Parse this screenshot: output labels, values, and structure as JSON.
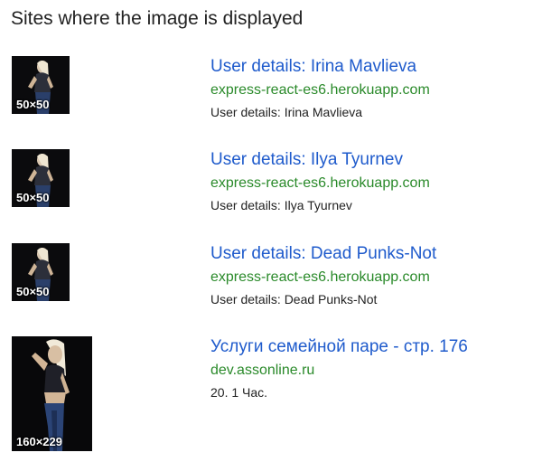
{
  "heading": "Sites where the image is displayed",
  "colors": {
    "title_link": "#1f5bcc",
    "url": "#2a8a2a",
    "text": "#222222",
    "thumb_bg": "#0b0b0d"
  },
  "results": [
    {
      "thumb_size": "50×50",
      "title": "User details: Irina Mavlieva",
      "url": "express-react-es6.herokuapp.com",
      "snippet": "User details: Irina Mavlieva"
    },
    {
      "thumb_size": "50×50",
      "title": "User details: Ilya Tyurnev",
      "url": "express-react-es6.herokuapp.com",
      "snippet": "User details: Ilya Tyurnev"
    },
    {
      "thumb_size": "50×50",
      "title": "User details: Dead Punks-Not",
      "url": "express-react-es6.herokuapp.com",
      "snippet": "User details: Dead Punks-Not"
    },
    {
      "thumb_size": "160×229",
      "title": "Услуги семейной паре - стр. 176",
      "url": "dev.assonline.ru",
      "snippet": "20. 1 Час."
    }
  ]
}
